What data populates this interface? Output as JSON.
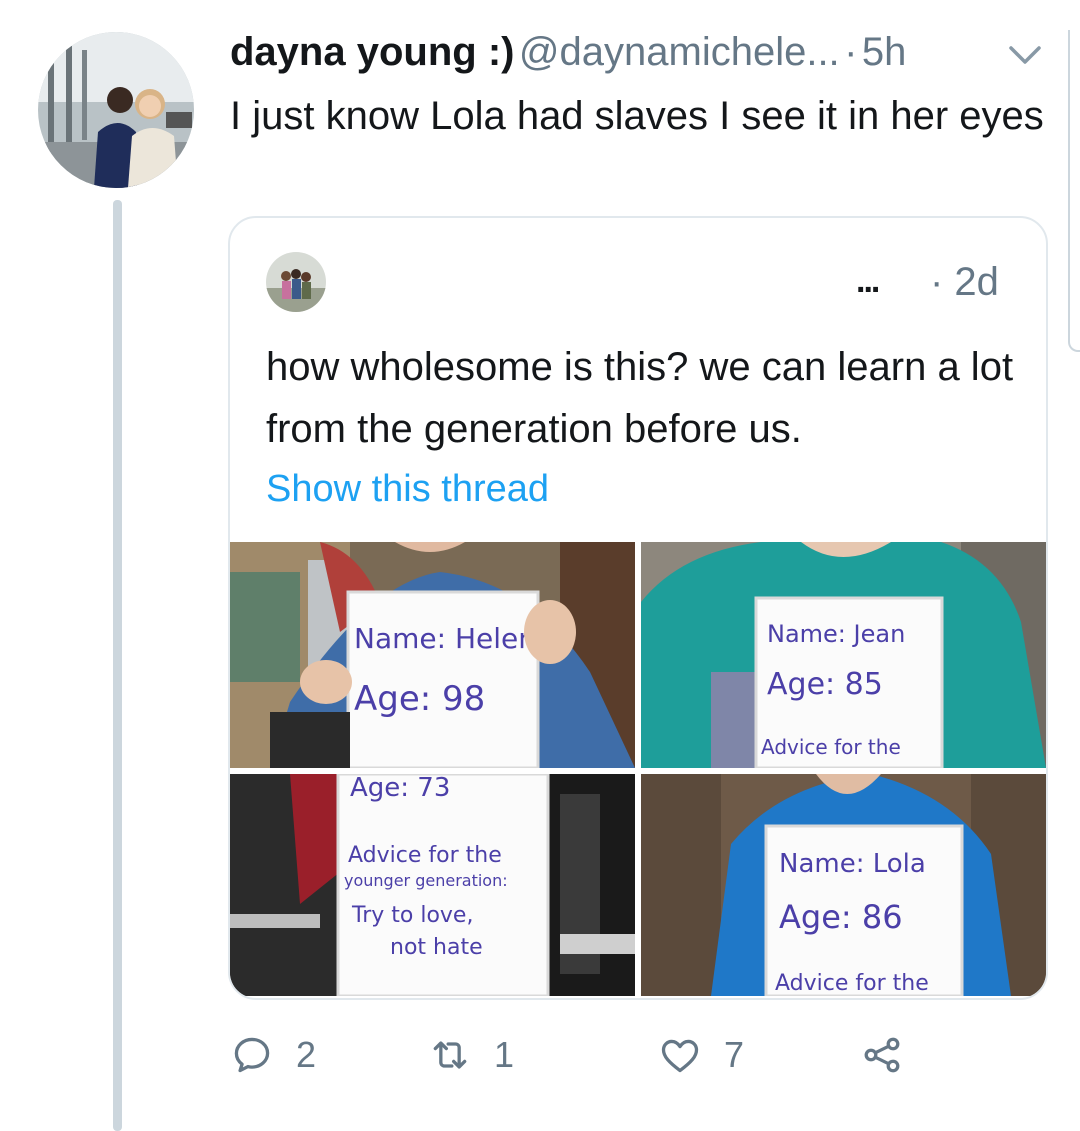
{
  "tweet": {
    "display_name": "dayna young :)",
    "handle": "@daynamichele...",
    "separator": "·",
    "time": "5h",
    "text": "I just know Lola had slaves I see it in her eyes",
    "avatar_icon": "profile-photo"
  },
  "quoted_tweet": {
    "more_label": "...",
    "time": "· 2d",
    "text": "how wholesome is this? we can learn a lot from the generation before us.",
    "show_thread_label": "Show this thread",
    "photos": [
      {
        "board": [
          "Name: Helen",
          "Age: 98"
        ]
      },
      {
        "board": [
          "Name: Jean",
          "Age: 85",
          "Advice for the"
        ]
      },
      {
        "board": [
          "Age: 73",
          "Advice for the",
          "younger generation:",
          "Try to love,",
          "not hate"
        ]
      },
      {
        "board": [
          "Name: Lola",
          "Age: 86",
          "Advice for the"
        ]
      }
    ]
  },
  "actions": {
    "reply_count": "2",
    "retweet_count": "1",
    "like_count": "7",
    "icons": [
      "reply-icon",
      "retweet-icon",
      "like-icon",
      "share-icon"
    ]
  },
  "colors": {
    "accent": "#1da1f2",
    "muted": "#657786",
    "border": "#e1e8ed",
    "thread_line": "#ccd6dd",
    "board_ink": "#4b3fa8"
  }
}
